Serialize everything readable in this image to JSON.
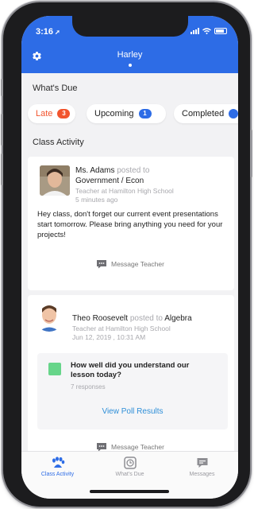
{
  "status_bar": {
    "time": "3:16"
  },
  "header": {
    "title": "Harley"
  },
  "whats_due": {
    "title": "What's Due",
    "filters": [
      {
        "label": "Late",
        "count": "3",
        "color": "#f2542d"
      },
      {
        "label": "Upcoming",
        "count": "1",
        "color": "#2d6ce6"
      },
      {
        "label": "Completed",
        "count": "",
        "color": "#2d6ce6"
      }
    ]
  },
  "class_activity": {
    "title": "Class Activity",
    "posts": [
      {
        "author": "Ms. Adams",
        "posted_to_text": "posted to",
        "class_name": "Government / Econ",
        "role": "Teacher at Hamilton High School",
        "time": "5 minutes ago",
        "body": "Hey class, don't forget our current event presentations start tomorrow. Please bring anything you need for your projects!",
        "message_label": "Message Teacher"
      },
      {
        "author": "Theo Roosevelt",
        "posted_to_text": "posted to",
        "class_name": "Algebra",
        "role": "Teacher at Hamilton High School",
        "time": "Jun 12, 2019 , 10:31 AM",
        "poll": {
          "question": "How well did you understand our lesson today?",
          "responses": "7 responses",
          "link": "View Poll Results"
        },
        "message_label": "Message Teacher"
      }
    ]
  },
  "tabbar": {
    "tabs": [
      {
        "label": "Class Activity",
        "icon": "paw-icon",
        "active": true
      },
      {
        "label": "What's Due",
        "icon": "clock-icon",
        "active": false
      },
      {
        "label": "Messages",
        "icon": "message-icon",
        "active": false
      }
    ]
  },
  "colors": {
    "brand": "#2d6ce6",
    "late": "#f2542d",
    "link": "#2f8fd8",
    "poll_icon": "#67d58a"
  }
}
